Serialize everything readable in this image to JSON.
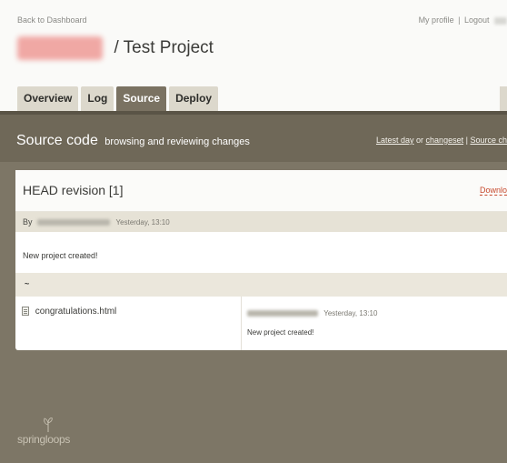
{
  "header": {
    "back_link": "Back to Dashboard",
    "my_profile": "My profile",
    "separator": "|",
    "logout": "Logout",
    "project_title": "/ Test Project"
  },
  "tabs": [
    {
      "label": "Overview",
      "active": false
    },
    {
      "label": "Log",
      "active": false
    },
    {
      "label": "Source",
      "active": true
    },
    {
      "label": "Deploy",
      "active": false
    }
  ],
  "section": {
    "title": "Source code",
    "subtitle": "browsing and reviewing changes",
    "link_latest_day": "Latest day",
    "link_or": "or",
    "link_changeset": "changeset",
    "link_sep": "|",
    "link_source": "Source ch"
  },
  "revision": {
    "title": "HEAD revision [1]",
    "download": "Downlo",
    "by_label": "By",
    "time": "Yesterday, 13:10",
    "message": "New project created!",
    "directory": "~"
  },
  "files": [
    {
      "name": "congratulations.html",
      "time": "Yesterday, 13:10",
      "message": "New project created!"
    }
  ],
  "footer": {
    "logo": "springloops"
  },
  "colors": {
    "band": "#6f6858",
    "lower_bg": "#7d7666",
    "active_tab": "#7a7262",
    "tab": "#dcd8cc",
    "download_link": "#c74a2e"
  }
}
